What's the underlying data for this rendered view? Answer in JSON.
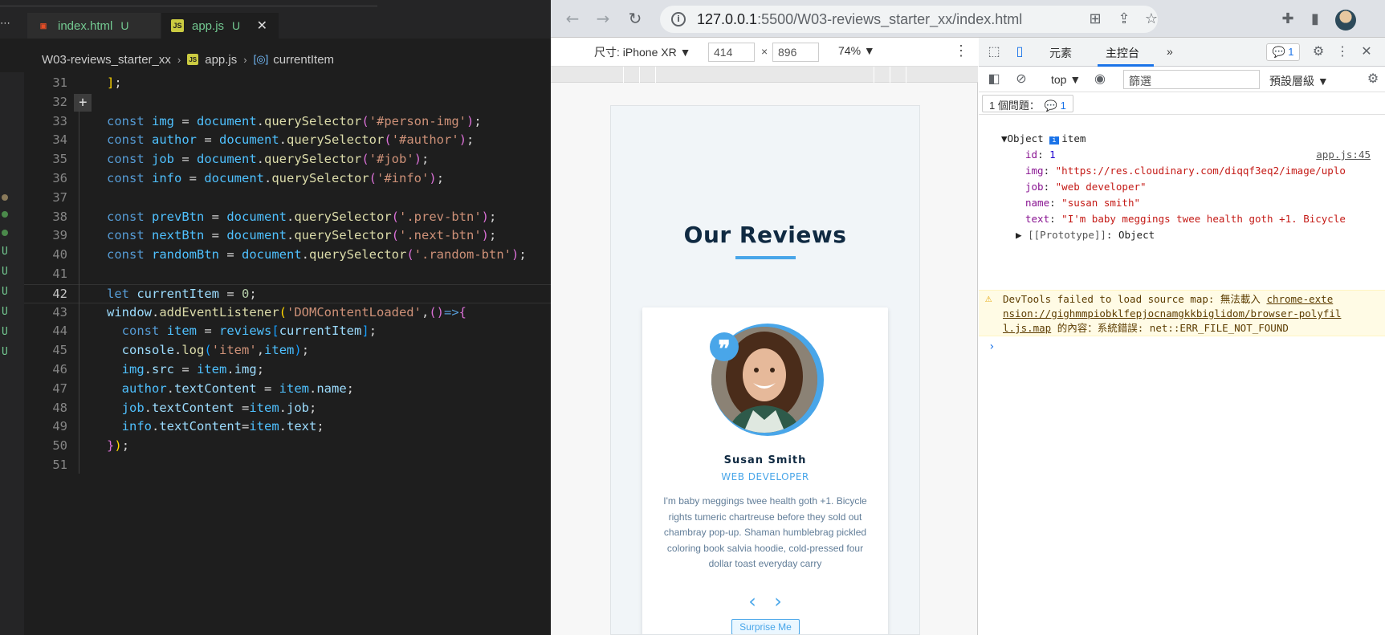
{
  "editor": {
    "tabs": [
      {
        "label": "index.html",
        "status": "U"
      },
      {
        "label": "app.js",
        "status": "U"
      }
    ],
    "breadcrumb": [
      "W03-reviews_starter_xx",
      "app.js",
      "currentItem"
    ],
    "gutter_status": [
      "U",
      "U",
      "U",
      "U",
      "U",
      "U"
    ],
    "line_numbers": [
      "31",
      "32",
      "33",
      "34",
      "35",
      "36",
      "37",
      "38",
      "39",
      "40",
      "41",
      "42",
      "43",
      "44",
      "45",
      "46",
      "47",
      "48",
      "49",
      "50",
      "51"
    ]
  },
  "browser": {
    "url_host": "127.0.0.1",
    "url_path": ":5500/W03-reviews_starter_xx/index.html",
    "device": {
      "label": "尺寸: iPhone XR ▼",
      "width": "414",
      "times": "×",
      "height": "896",
      "zoom": "74% ▼"
    },
    "page": {
      "title": "Our Reviews",
      "name": "Susan Smith",
      "job": "WEB DEVELOPER",
      "text": "I'm baby meggings twee health goth +1. Bicycle rights tumeric chartreuse before they sold out chambray pop-up. Shaman humblebrag pickled coloring book salvia hoodie, cold-pressed four dollar toast everyday carry",
      "prev": "‹",
      "next": "›",
      "random": "Surprise Me",
      "quote": "❞"
    }
  },
  "devtools": {
    "tabs": {
      "elements": "元素",
      "console": "主控台",
      "more": "»"
    },
    "badge": "1",
    "context": "top ▼",
    "filter_placeholder": "篩選",
    "levels": "預設層級 ▼",
    "issues": "1 個問題：",
    "issues_count": "1",
    "log": {
      "label": "item",
      "source": "app.js:45",
      "object": "Object",
      "id_key": "id",
      "id_val": "1",
      "img_key": "img",
      "img_val": "\"https://res.cloudinary.com/diqqf3eq2/image/uplo",
      "job_key": "job",
      "job_val": "\"web developer\"",
      "name_key": "name",
      "name_val": "\"susan smith\"",
      "text_key": "text",
      "text_val": "\"I'm baby meggings twee health goth +1. Bicycle",
      "proto": "[[Prototype]]",
      "proto_val": "Object"
    },
    "warning": {
      "line1_a": "DevTools failed to load source map: 無法載入 ",
      "line1_link": "chrome-exte",
      "line2_link": "nsion://gighmmpiobklfepjocnamgkkbiglidom/browser-polyfil",
      "line3_link": "l.js.map",
      "line3_b": " 的內容：系統錯誤: net::ERR_FILE_NOT_FOUND"
    },
    "prompt": "›"
  }
}
